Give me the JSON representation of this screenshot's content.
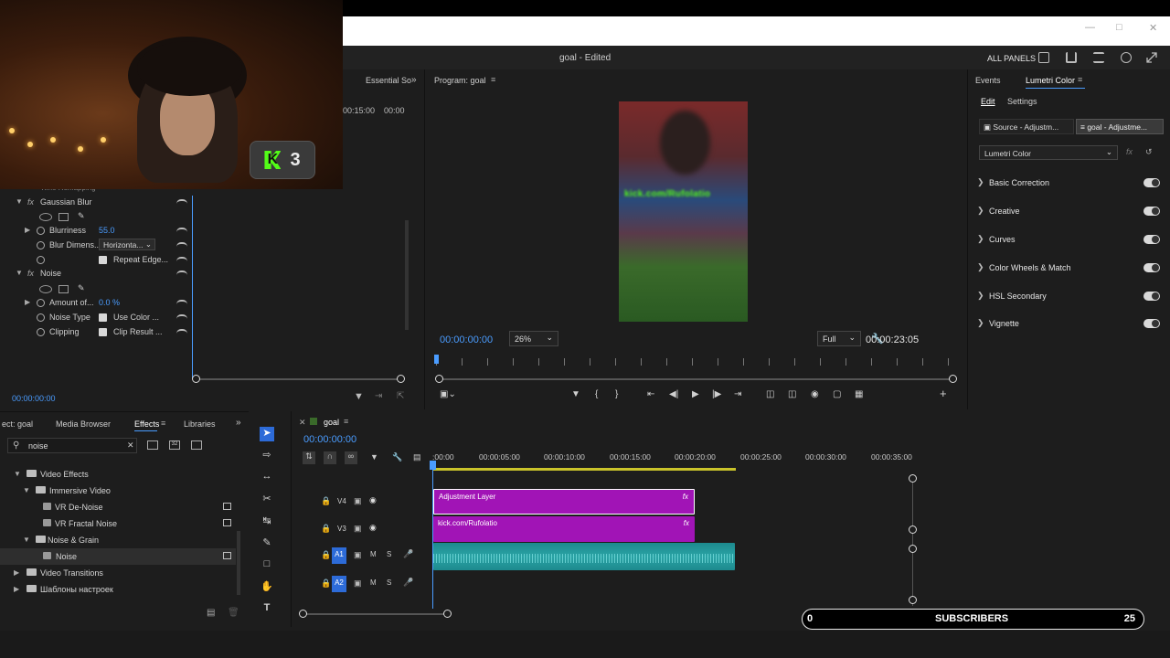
{
  "app": {
    "title": "goal - Edited",
    "all_panels": "ALL PANELS"
  },
  "webcam": {
    "badge_number": "3",
    "badge_logo": "K"
  },
  "effects_controls": {
    "essential_tab": "Essential So",
    "ruler_time1": "00:15:00",
    "ruler_time2": "00:00",
    "time_remapping": "Time Remapping",
    "gaussian_blur": "Gaussian Blur",
    "blurriness_label": "Blurriness",
    "blurriness_value": "55.0",
    "blur_dim_label": "Blur Dimens...",
    "blur_dim_value": "Horizonta...",
    "repeat_edge": "Repeat Edge...",
    "noise": "Noise",
    "amount_label": "Amount of...",
    "amount_value": "0.0 %",
    "noise_type_label": "Noise Type",
    "noise_type_value": "Use Color ...",
    "clipping_label": "Clipping",
    "clipping_value": "Clip Result ...",
    "timecode": "00:00:00:00"
  },
  "program": {
    "title": "Program: goal",
    "timecode": "00:00:00:00",
    "zoom": "26%",
    "resolution": "Full",
    "duration": "00:00:23:05",
    "video_overlay": "kick.com/Rufolatio"
  },
  "lumetri": {
    "tab_events": "Events",
    "tab_lumetri": "Lumetri Color",
    "sub_edit": "Edit",
    "sub_settings": "Settings",
    "source_btn": "Source - Adjustm...",
    "goal_btn": "goal - Adjustme...",
    "effect_select": "Lumetri Color",
    "sections": [
      "Basic Correction",
      "Creative",
      "Curves",
      "Color Wheels & Match",
      "HSL Secondary",
      "Vignette"
    ]
  },
  "project": {
    "tabs": [
      "ect: goal",
      "Media Browser",
      "Effects",
      "Libraries"
    ],
    "search_value": "noise",
    "tree": [
      {
        "label": "Video Effects",
        "depth": 1
      },
      {
        "label": "Immersive Video",
        "depth": 2
      },
      {
        "label": "VR De-Noise",
        "depth": 3
      },
      {
        "label": "VR Fractal Noise",
        "depth": 3
      },
      {
        "label": "Noise & Grain",
        "depth": 2
      },
      {
        "label": "Noise",
        "depth": 3
      },
      {
        "label": "Video Transitions",
        "depth": 1
      },
      {
        "label": "Шаблоны настроек",
        "depth": 1
      }
    ]
  },
  "timeline": {
    "seq_name": "goal",
    "timecode": "00:00:00:00",
    "times": [
      ":00:00",
      "00:00:05:00",
      "00:00:10:00",
      "00:00:15:00",
      "00:00:20:00",
      "00:00:25:00",
      "00:00:30:00",
      "00:00:35:00"
    ],
    "tracks": [
      "V4",
      "V3",
      "A1",
      "A2"
    ],
    "clip1": "Adjustment Layer",
    "clip2": "kick.com/Rufolatio",
    "fx": "fx",
    "m": "M",
    "s": "S"
  },
  "subscribers": {
    "left": "0",
    "label": "SUBSCRIBERS",
    "right": "25"
  }
}
